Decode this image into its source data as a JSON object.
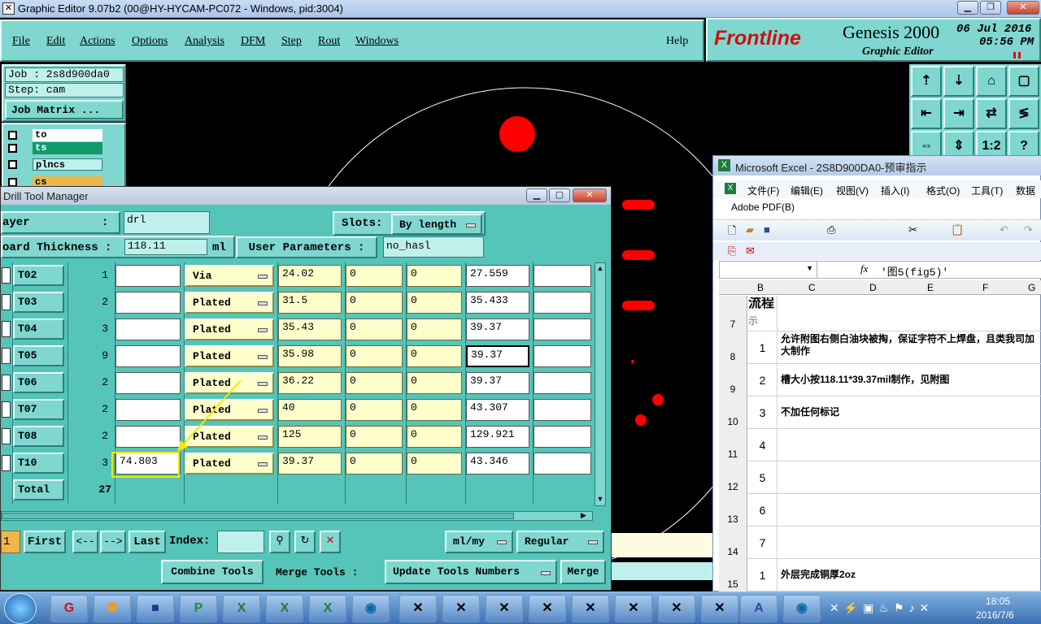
{
  "window": {
    "title": "Graphic Editor 9.07b2 (00@HY-HYCAM-PC072 - Windows, pid:3004)"
  },
  "menubar": {
    "items": [
      "File",
      "Edit",
      "Actions",
      "Options",
      "Analysis",
      "DFM",
      "Step",
      "Rout",
      "Windows"
    ],
    "help": "Help"
  },
  "brand": {
    "logo": "Frontline",
    "product": "Genesis 2000",
    "subtitle": "Graphic Editor",
    "date": "06 Jul 2016",
    "time": "05:56 PM"
  },
  "left_panel": {
    "job": "Job : 2s8d900da0",
    "step": "Step: cam",
    "job_matrix": "Job Matrix ...",
    "layers": [
      "to",
      "ts",
      "plncs",
      "cs"
    ]
  },
  "right_toolbar": {
    "icons": [
      "home-icon",
      "down-icon",
      "house-icon",
      "zoom-box-icon",
      "left-arrow-icon",
      "right-arrow-icon",
      "swap-icon",
      "mirror-icon",
      "expand-icon",
      "fit-icon",
      "scale-icon",
      "help-icon"
    ],
    "scale_label": "1:2",
    "help_label": "?"
  },
  "dtm": {
    "title": "Drill Tool Manager",
    "layer_label": "ayer",
    "layer_sep": ":",
    "layer_value": "drl",
    "slots_label": "Slots:",
    "slots_value": "By length",
    "board_thickness_label": "oard Thickness :",
    "board_thickness_value": "118.11",
    "units": "ml",
    "user_params_label": "User Parameters :",
    "user_params_value": "no_hasl",
    "rows": [
      {
        "tool": "T02",
        "count": "1",
        "field1": "",
        "type": "Via",
        "size": "24.02",
        "p1": "0",
        "p2": "0",
        "finish": "27.559",
        "extra": ""
      },
      {
        "tool": "T03",
        "count": "2",
        "field1": "",
        "type": "Plated",
        "size": "31.5",
        "p1": "0",
        "p2": "0",
        "finish": "35.433",
        "extra": ""
      },
      {
        "tool": "T04",
        "count": "3",
        "field1": "",
        "type": "Plated",
        "size": "35.43",
        "p1": "0",
        "p2": "0",
        "finish": "39.37",
        "extra": ""
      },
      {
        "tool": "T05",
        "count": "9",
        "field1": "",
        "type": "Plated",
        "size": "35.98",
        "p1": "0",
        "p2": "0",
        "finish": "39.37",
        "extra": ""
      },
      {
        "tool": "T06",
        "count": "2",
        "field1": "",
        "type": "Plated",
        "size": "36.22",
        "p1": "0",
        "p2": "0",
        "finish": "39.37",
        "extra": ""
      },
      {
        "tool": "T07",
        "count": "2",
        "field1": "",
        "type": "Plated",
        "size": "40",
        "p1": "0",
        "p2": "0",
        "finish": "43.307",
        "extra": ""
      },
      {
        "tool": "T08",
        "count": "2",
        "field1": "",
        "type": "Plated",
        "size": "125",
        "p1": "0",
        "p2": "0",
        "finish": "129.921",
        "extra": ""
      },
      {
        "tool": "T10",
        "count": "3",
        "field1": "74.803",
        "type": "Plated",
        "size": "39.37",
        "p1": "0",
        "p2": "0",
        "finish": "43.346",
        "extra": ""
      }
    ],
    "total_label": "Total",
    "total_value": "27",
    "nav": {
      "page": "1",
      "first": "First",
      "prev": "<--",
      "next": "-->",
      "last": "Last",
      "index_label": "Index:",
      "units": "ml/my",
      "mode": "Regular"
    },
    "actions": {
      "combine": "Combine Tools",
      "merge_label": "Merge Tools :",
      "update": "Update Tools Numbers",
      "merge": "Merge"
    }
  },
  "excel": {
    "title": "Microsoft Excel - 2S8D900DA0-预审指示",
    "menu": [
      "文件(F)",
      "编辑(E)",
      "视图(V)",
      "插入(I)",
      "格式(O)",
      "工具(T)",
      "数据"
    ],
    "adobe": "Adobe PDF(B)",
    "formula": "'图5(fig5)'",
    "fx": "fx",
    "cols": [
      "B",
      "C",
      "D",
      "E",
      "F",
      "G"
    ],
    "rows": [
      {
        "rownum": "7",
        "b": "",
        "c": "流程",
        "sub": "示"
      },
      {
        "rownum": "8",
        "b": "1",
        "c": "允许附图右侧白油块被掏，保证字符不上焊盘，且类我司加大制作"
      },
      {
        "rownum": "9",
        "b": "2",
        "c": "槽大小按118.11*39.37mil制作，见附图"
      },
      {
        "rownum": "10",
        "b": "3",
        "c": "不加任何标记"
      },
      {
        "rownum": "11",
        "b": "4",
        "c": ""
      },
      {
        "rownum": "12",
        "b": "5",
        "c": ""
      },
      {
        "rownum": "13",
        "b": "6",
        "c": ""
      },
      {
        "rownum": "14",
        "b": "7",
        "c": ""
      },
      {
        "rownum": "15",
        "b": "1",
        "c": "外层完成铜厚2oz"
      }
    ]
  },
  "taskbar": {
    "time": "18:05",
    "date": "2016/7/6"
  }
}
